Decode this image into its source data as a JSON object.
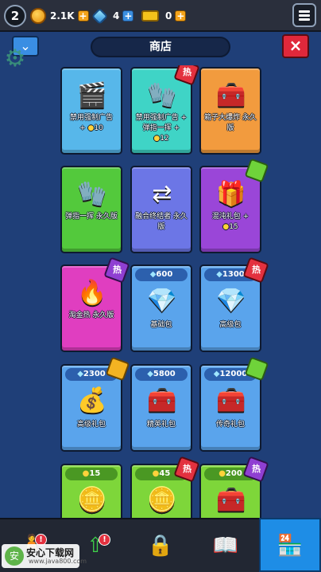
{
  "top_bar": {
    "level": "2",
    "coins": "2.1K",
    "gems": "4",
    "tickets": "0",
    "plus_symbol": "+"
  },
  "header": {
    "title": "商店",
    "chevron_symbol": "⌄",
    "close_symbol": "×"
  },
  "colors": {
    "background": "#1f3f78",
    "hot_badge": "#e3313f",
    "active_tab": "#1e8de6"
  },
  "cards": [
    {
      "label": "禁用强制广告",
      "cost_prefix": "+",
      "cost": "10",
      "icon": "clapperboard-no-icon"
    },
    {
      "label": "禁用强制广告 + 弹指一挥 +",
      "cost": "12",
      "badge": "热",
      "icon": "clapperboard-glove-icon"
    },
    {
      "label": "箱子大爆炸 永久版",
      "icon": "chest-icon"
    },
    {
      "label": "弹指一挥 永久版",
      "icon": "gauntlet-icon"
    },
    {
      "label": "融合终结者 永久版",
      "icon": "merge-arrows-icon"
    },
    {
      "label": "混沌礼包 +",
      "cost": "15",
      "icon": "chaos-bundle-icon"
    },
    {
      "label": "淘金热 永久版",
      "badge": "热",
      "icon": "gold-rush-icon"
    },
    {
      "label": "基础包",
      "price": "600",
      "icon": "gems-small-icon"
    },
    {
      "label": "高级包",
      "price": "1300",
      "badge": "热",
      "icon": "gems-large-icon"
    },
    {
      "label": "高级礼包",
      "price": "2300",
      "icon": "sack-icon"
    },
    {
      "label": "精英礼包",
      "price": "5800",
      "icon": "elite-chest-icon"
    },
    {
      "label": "传奇礼包",
      "price": "12000",
      "icon": "legend-chest-icon"
    },
    {
      "label": "一",
      "price": "15",
      "icon": "gold-bars-icon"
    },
    {
      "label": "一",
      "price": "45",
      "badge": "热",
      "icon": "gold-pot-icon"
    },
    {
      "label": "一",
      "price": "200",
      "badge": "热",
      "icon": "gold-chest-icon"
    }
  ],
  "icons": {
    "clapperboard": "🎬",
    "glove": "🧤",
    "chest": "🧰",
    "arrows": "⇄",
    "gift": "🎁",
    "fire": "🔥",
    "gem": "💎",
    "sack": "💰",
    "gold": "🪙",
    "gear": "⚙"
  },
  "bottom_nav": {
    "alert_symbol": "!",
    "tabs": [
      "inventory",
      "upgrades",
      "locked",
      "quests",
      "shop"
    ]
  },
  "watermark": {
    "main": "安心下载网",
    "sub": "www.java800.com",
    "logo_text": "安"
  }
}
